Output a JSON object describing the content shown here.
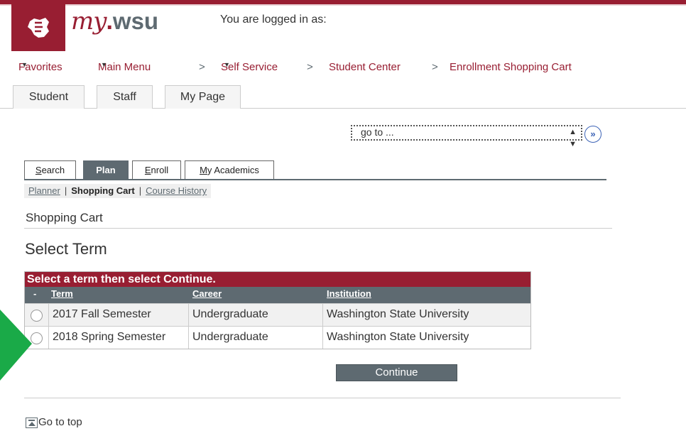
{
  "header": {
    "brand_my": "my",
    "brand_dot": ".",
    "brand_wsu": "wsu",
    "logged_in": "You are logged in as:"
  },
  "nav": {
    "favorites": "Favorites",
    "main_menu": "Main Menu",
    "sep": ">",
    "self_service": "Self Service",
    "student_center": "Student Center",
    "enrollment_cart": "Enrollment Shopping Cart"
  },
  "tabs": [
    "Student",
    "Staff",
    "My Page"
  ],
  "goto": {
    "value": "go to ...",
    "button": "»"
  },
  "page_tabs": {
    "search": {
      "first": "S",
      "rest": "earch"
    },
    "plan": "Plan",
    "enroll": {
      "first": "E",
      "rest": "nroll"
    },
    "academics": {
      "first": "M",
      "rest": "y Academics"
    }
  },
  "subnav": {
    "planner": "Planner",
    "bar": "|",
    "shopping_cart": "Shopping Cart",
    "course_history": "Course History"
  },
  "page_title": "Shopping Cart",
  "section_title": "Select Term",
  "grid": {
    "header": "Select a term then select Continue.",
    "col_select": "-",
    "columns": [
      "Term",
      "Career",
      "Institution"
    ],
    "rows": [
      {
        "term": "2017 Fall Semester",
        "career": "Undergraduate",
        "institution": "Washington State University"
      },
      {
        "term": "2018 Spring Semester",
        "career": "Undergraduate",
        "institution": "Washington State University"
      }
    ]
  },
  "continue": "Continue",
  "go_to_top": "Go to top",
  "colors": {
    "crimson": "#981e32",
    "gray": "#5e6a71",
    "arrow_green": "#1aaa48"
  }
}
